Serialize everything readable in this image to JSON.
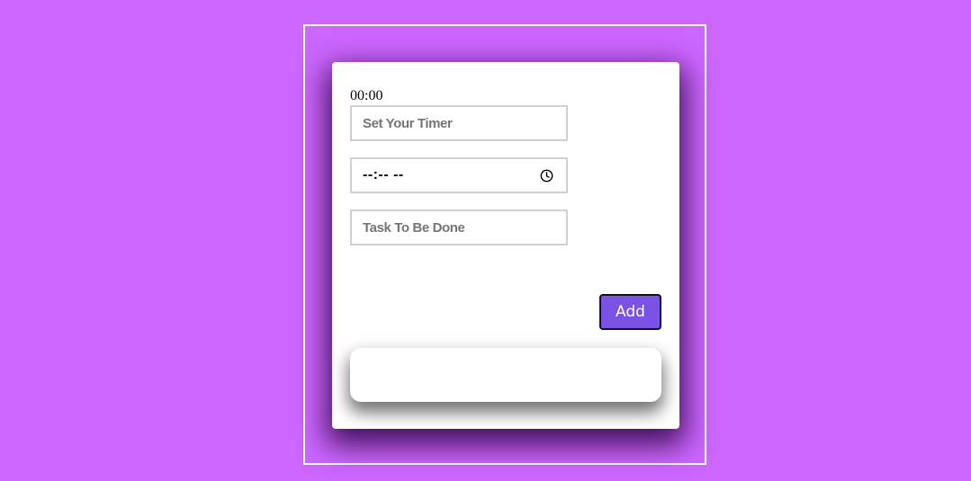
{
  "timer": {
    "display": "00:00"
  },
  "form": {
    "timer_placeholder": "Set Your Timer",
    "time_value": "--:-- --",
    "task_placeholder": "Task To Be Done",
    "add_label": "Add"
  },
  "task_list": {
    "items": []
  },
  "colors": {
    "page_background": "#cc66ff",
    "card_background": "#ffffff",
    "add_button": "#7b52e6"
  }
}
